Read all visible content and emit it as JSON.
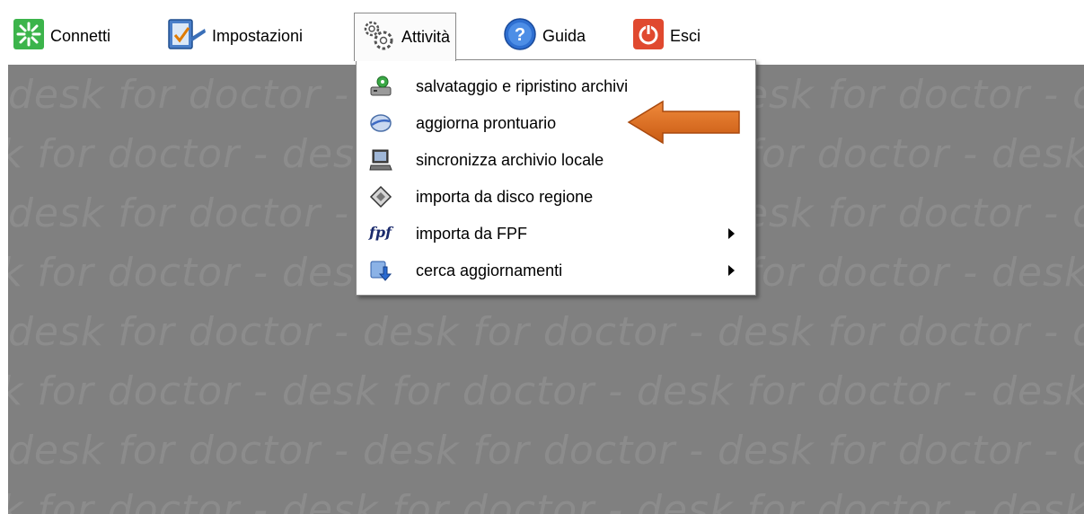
{
  "menubar": {
    "items": [
      {
        "label": "Connetti",
        "icon": "connect-icon"
      },
      {
        "label": "Impostazioni",
        "icon": "settings-icon"
      },
      {
        "label": "Attività",
        "icon": "gears-icon"
      },
      {
        "label": "Guida",
        "icon": "help-icon"
      },
      {
        "label": "Esci",
        "icon": "power-icon"
      }
    ]
  },
  "dropdown": {
    "items": [
      {
        "label": "salvataggio e ripristino archivi",
        "icon": "backup-drive-icon",
        "submenu": false
      },
      {
        "label": "aggiorna prontuario",
        "icon": "disk-update-icon",
        "submenu": false
      },
      {
        "label": "sincronizza archivio locale",
        "icon": "computer-icon",
        "submenu": false
      },
      {
        "label": "importa da disco regione",
        "icon": "disk-import-icon",
        "submenu": false
      },
      {
        "label": "importa da FPF",
        "icon": "fpf-icon",
        "icon_text": "fpf",
        "submenu": true
      },
      {
        "label": "cerca aggiornamenti",
        "icon": "download-update-icon",
        "submenu": true
      }
    ]
  },
  "workspace": {
    "watermark_text": "desk for doctor - desk for doctor - desk for doctor - desk for doctor - desk for doctor"
  },
  "colors": {
    "workspace_bg": "#808080",
    "watermark": "#8c8c8c",
    "annotation_arrow": "#d9691c"
  }
}
